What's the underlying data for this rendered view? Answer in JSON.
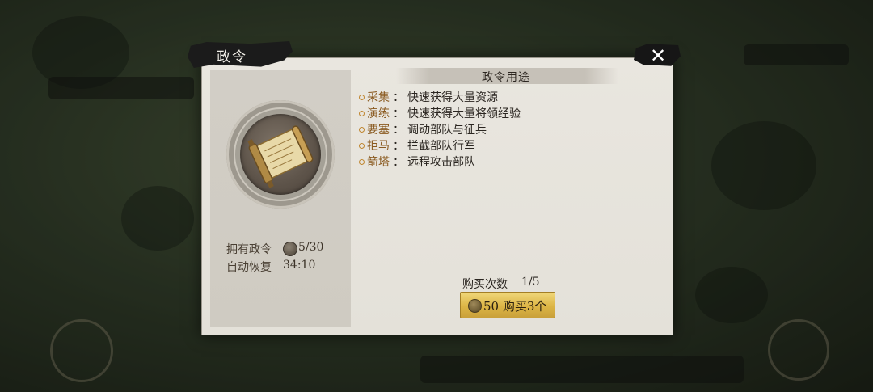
{
  "dialog": {
    "title": "政令",
    "close_label": "✕"
  },
  "emblem": {
    "icon": "decree-scroll-icon"
  },
  "stats": {
    "owned_label": "拥有政令",
    "owned_value": "5/30",
    "recover_label": "自动恢复",
    "recover_value": "34:10"
  },
  "usage": {
    "title": "政令用途",
    "items": [
      {
        "name": "采集",
        "desc": "快速获得大量资源"
      },
      {
        "name": "演练",
        "desc": "快速获得大量将领经验"
      },
      {
        "name": "要塞",
        "desc": "调动部队与征兵"
      },
      {
        "name": "拒马",
        "desc": "拦截部队行军"
      },
      {
        "name": "箭塔",
        "desc": "远程攻击部队"
      }
    ],
    "separator": "："
  },
  "purchase": {
    "count_label": "购买次数",
    "count_value": "1/5",
    "button_label": "50 购买3个"
  },
  "colors": {
    "accent_gold": "#dcb545",
    "usage_name": "#8a5a20",
    "panel_bg": "#e6e3dc"
  }
}
